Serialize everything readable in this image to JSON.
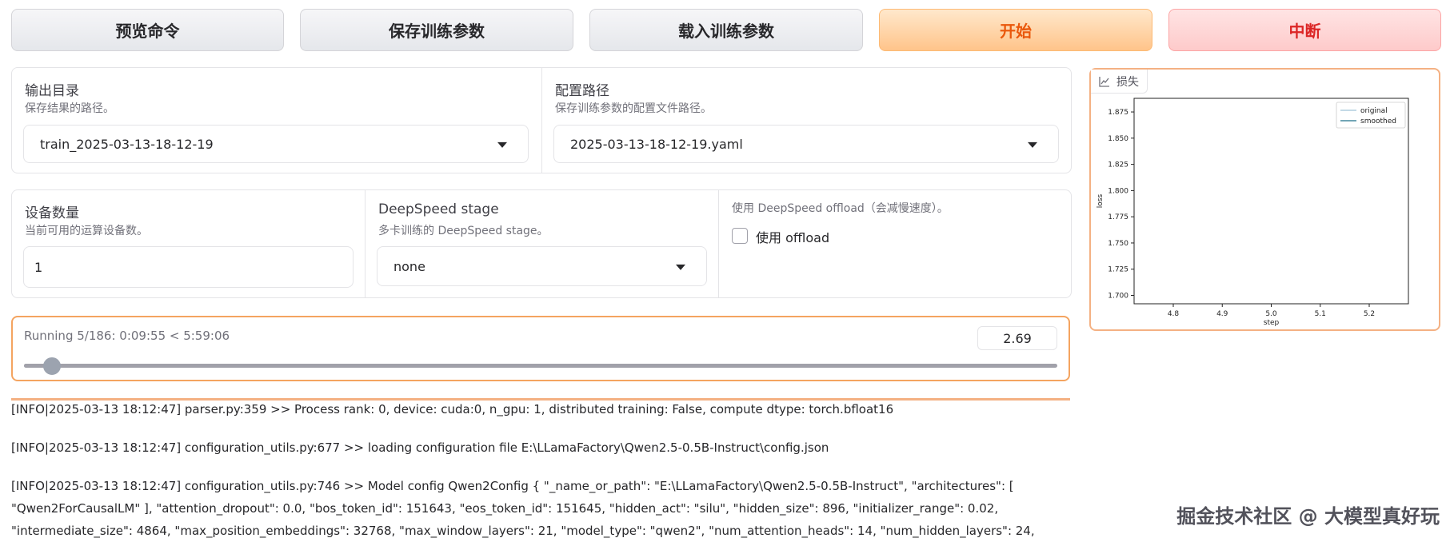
{
  "toolbar": {
    "preview_label": "预览命令",
    "save_label": "保存训练参数",
    "load_label": "载入训练参数",
    "start_label": "开始",
    "abort_label": "中断"
  },
  "output_dir": {
    "label": "输出目录",
    "info": "保存结果的路径。",
    "value": "train_2025-03-13-18-12-19"
  },
  "config_path": {
    "label": "配置路径",
    "info": "保存训练参数的配置文件路径。",
    "value": "2025-03-13-18-12-19.yaml"
  },
  "device_count": {
    "label": "设备数量",
    "info": "当前可用的运算设备数。",
    "value": "1"
  },
  "ds_stage": {
    "label": "DeepSpeed stage",
    "info": "多卡训练的 DeepSpeed stage。",
    "value": "none"
  },
  "ds_offload": {
    "info": "使用 DeepSpeed offload（会减慢速度）。",
    "checkbox_label": "使用 offload"
  },
  "progress": {
    "text": "Running 5/186: 0:09:55 < 5:59:06",
    "value": "2.69",
    "fraction": 0.027
  },
  "logs": [
    "[INFO|2025-03-13 18:12:47] parser.py:359 >> Process rank: 0, device: cuda:0, n_gpu: 1, distributed training: False, compute dtype: torch.bfloat16",
    "[INFO|2025-03-13 18:12:47] configuration_utils.py:677 >> loading configuration file E:\\LLamaFactory\\Qwen2.5-0.5B-Instruct\\config.json",
    "[INFO|2025-03-13 18:12:47] configuration_utils.py:746 >> Model config Qwen2Config { \"_name_or_path\": \"E:\\LLamaFactory\\Qwen2.5-0.5B-Instruct\", \"architectures\": [",
    "\"Qwen2ForCausalLM\" ], \"attention_dropout\": 0.0, \"bos_token_id\": 151643, \"eos_token_id\": 151645, \"hidden_act\": \"silu\", \"hidden_size\": 896, \"initializer_range\": 0.02,",
    "\"intermediate_size\": 4864, \"max_position_embeddings\": 32768, \"max_window_layers\": 21, \"model_type\": \"qwen2\", \"num_attention_heads\": 14, \"num_hidden_layers\": 24,"
  ],
  "chart_panel": {
    "tag_label": "损失",
    "tag_icon": "chart-icon"
  },
  "chart_data": {
    "type": "line",
    "xlabel": "step",
    "ylabel": "loss",
    "xlim": [
      4.72,
      5.28
    ],
    "ylim": [
      1.692,
      1.888
    ],
    "xticks": [
      "4.8",
      "4.9",
      "5.0",
      "5.1",
      "5.2"
    ],
    "xtick_values": [
      4.8,
      4.9,
      5.0,
      5.1,
      5.2
    ],
    "yticks": [
      "1.700",
      "1.725",
      "1.750",
      "1.775",
      "1.800",
      "1.825",
      "1.850",
      "1.875"
    ],
    "ytick_values": [
      1.7,
      1.725,
      1.75,
      1.775,
      1.8,
      1.825,
      1.85,
      1.875
    ],
    "series": [
      {
        "name": "original",
        "color": "#a0c4d8",
        "x": [],
        "y": []
      },
      {
        "name": "smoothed",
        "color": "#1f6f8b",
        "x": [],
        "y": []
      }
    ],
    "legend": "top-right"
  },
  "watermark": "掘金技术社区 @ 大模型真好玩",
  "colors": {
    "accent_orange": "#f4a460",
    "start_text": "#ea580c",
    "abort_text": "#dc2626"
  }
}
